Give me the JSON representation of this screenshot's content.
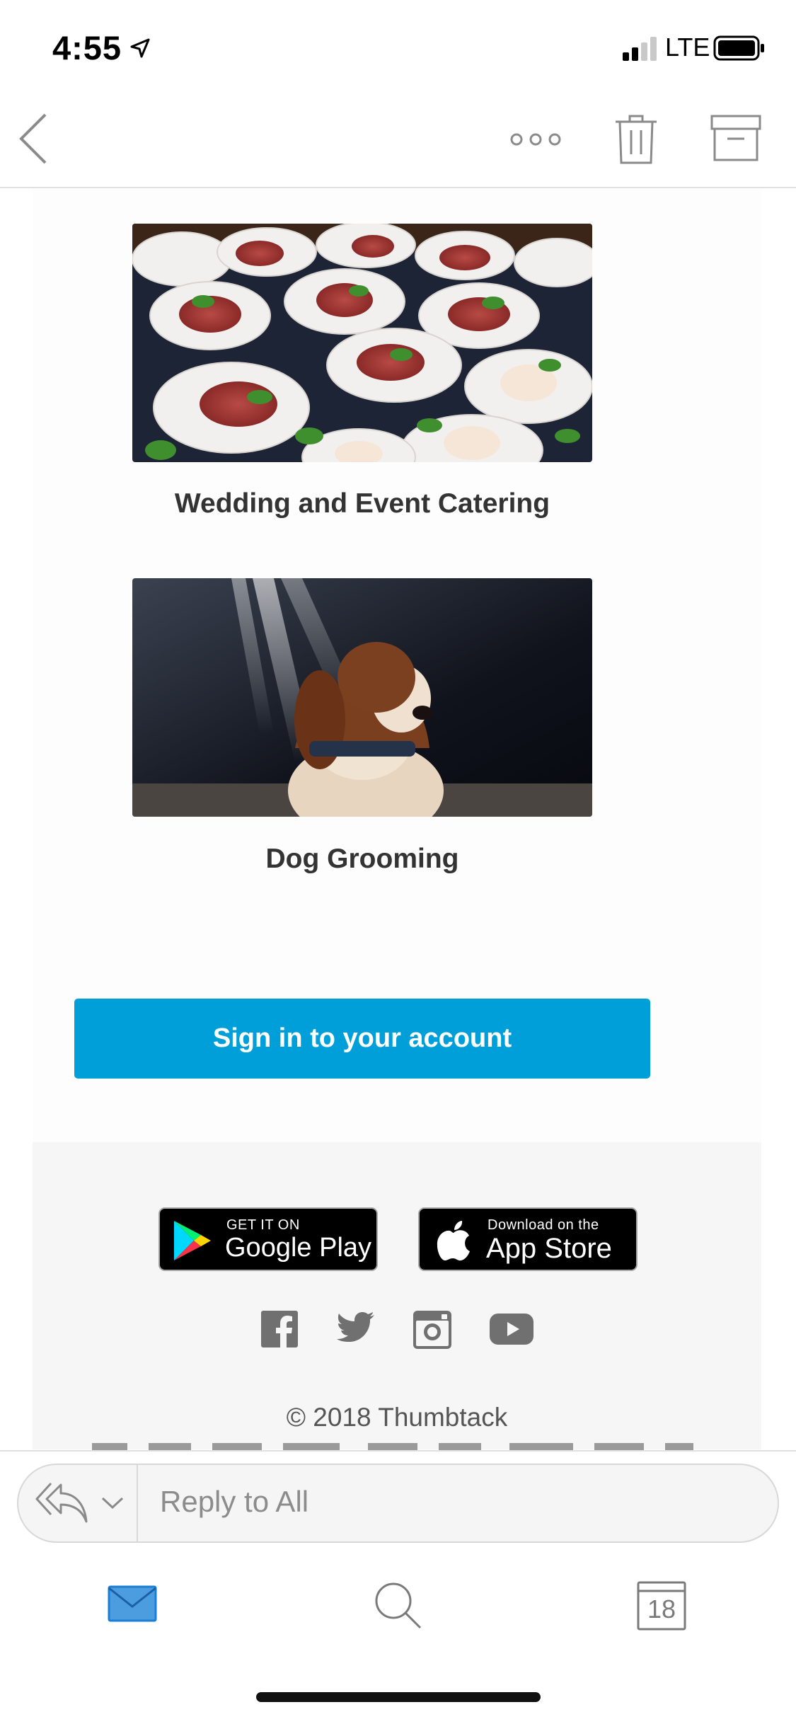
{
  "status_bar": {
    "time": "4:55",
    "network": "LTE"
  },
  "nav": {
    "back_icon": "chevron-left-icon",
    "more_icon": "more-dots-icon",
    "trash_icon": "trash-icon",
    "archive_icon": "archive-icon"
  },
  "cards": [
    {
      "title": "Wedding and Event Catering",
      "image": "catering-photo"
    },
    {
      "title": "Dog Grooming",
      "image": "dog-photo"
    }
  ],
  "signin_button": "Sign in to your account",
  "store_badges": {
    "google": {
      "small": "GET IT ON",
      "big": "Google Play"
    },
    "apple": {
      "small": "Download on the",
      "big": "App Store"
    }
  },
  "social_icons": [
    "facebook-icon",
    "twitter-icon",
    "instagram-icon",
    "youtube-icon"
  ],
  "footer": {
    "copyright": "© 2018 Thumbtack"
  },
  "reply": {
    "placeholder": "Reply to All"
  },
  "tab_bar": {
    "calendar_day": "18"
  },
  "colors": {
    "accent": "#009fd9",
    "mail_tab": "#1a7fd4"
  }
}
